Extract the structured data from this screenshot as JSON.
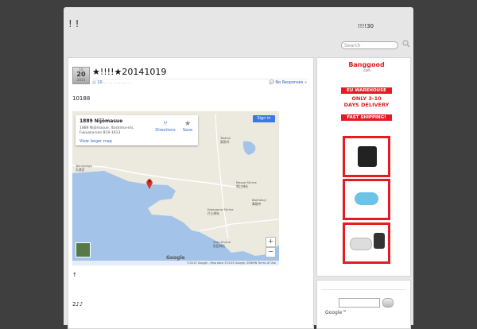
{
  "header": {
    "site_title": "! !",
    "tagline": "!!!!30",
    "search_placeholder": "Search"
  },
  "post": {
    "date": {
      "month": "10",
      "day": "20",
      "year": "2014"
    },
    "title": "★!!!!★20141019",
    "meta": "10 . . . . . . . . . . .",
    "comments": "No Responses »",
    "paragraph1": "10188",
    "paragraph2": "↑",
    "paragraph3": "2♪♪"
  },
  "map": {
    "place_name": "1889 Nijōmasue",
    "address_line1": "1889 Nijōmasue, Itoshima-shi,",
    "address_line2": "Fukuoka-ken 819-1613",
    "view_larger": "View larger map",
    "directions": "Directions",
    "save": "Save",
    "sign_in": "Sign in",
    "zoom_in": "+",
    "zoom_out": "−",
    "google": "Google",
    "footer": "©2015 Google - Map data ©2015 Google, ZENRIN    Terms of Use",
    "labels": {
      "toshoji": "Toshoji",
      "toshoji_jp": "東照寺",
      "temmangu": "Temmangu",
      "temmangu_jp": "天満宮",
      "masue": "Masue Shrine",
      "masue_jp": "増江神社",
      "banfukuji": "Banfukuji",
      "banfukuji_jp": "萬福寺",
      "katayama": "Katayama Shrine",
      "katayama_jp": "片山神社",
      "gion": "Gion Shrine",
      "gion_jp": "祇園神社"
    },
    "colors": {
      "sea": "#a3c3e8",
      "land": "#ece9df",
      "pin": "#d93025"
    }
  },
  "ad": {
    "logo": "Banggood",
    "logo_sub": ".com",
    "eu": "EU WAREHOUSE",
    "days1": "ONLY 3-10",
    "days2": "DAYS DELIVERY",
    "fast": "FAST SHIPPING!",
    "colors": {
      "accent": "#e31b23"
    }
  },
  "widget2": {
    "google": "Google™"
  }
}
